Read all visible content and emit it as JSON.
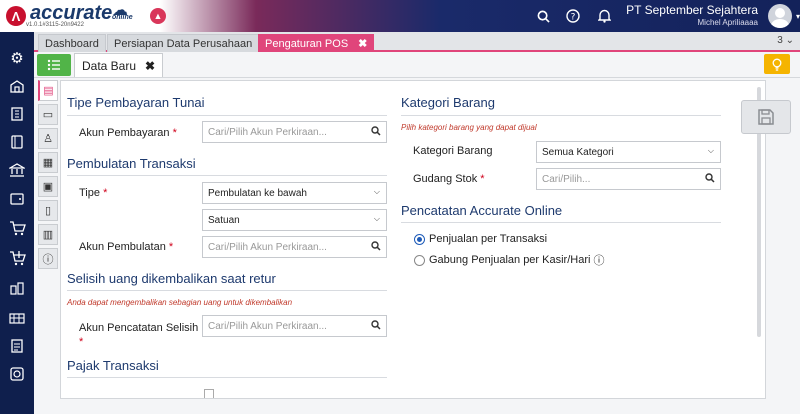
{
  "app": {
    "logo_text": "accurate",
    "logo_sub": "online",
    "version": "v1.0.1#3115-20n9422",
    "company_name": "PT September Sejahtera",
    "user_name": "Michel Apriliaaaa",
    "circle_badge": "▲"
  },
  "tabs": [
    {
      "label": "Dashboard"
    },
    {
      "label": "Persiapan Data Perusahaan"
    },
    {
      "label": "Pengaturan POS",
      "close": "✖"
    }
  ],
  "tab_count": "3 ⌄",
  "subtab": {
    "label": "Data Baru",
    "close": "✖"
  },
  "sections": {
    "tipe_pembayaran": {
      "title": "Tipe Pembayaran Tunai",
      "akun_label": "Akun Pembayaran",
      "akun_placeholder": "Cari/Pilih Akun Perkiraan..."
    },
    "pembulatan": {
      "title": "Pembulatan Transaksi",
      "tipe_label": "Tipe",
      "tipe_value": "Pembulatan ke bawah",
      "satuan_value": "Satuan",
      "akun_label": "Akun Pembulatan",
      "akun_placeholder": "Cari/Pilih Akun Perkiraan..."
    },
    "selisih": {
      "title": "Selisih uang dikembalikan saat retur",
      "note": "Anda dapat mengembalikan sebagian uang untuk dikembalikan",
      "akun_label": "Akun Pencatatan Selisih",
      "akun_placeholder": "Cari/Pilih Akun Perkiraan..."
    },
    "pajak": {
      "title": "Pajak Transaksi"
    },
    "kategori": {
      "title": "Kategori Barang",
      "note": "Pilih kategori barang yang dapat dijual",
      "kategori_label": "Kategori Barang",
      "kategori_value": "Semua Kategori",
      "gudang_label": "Gudang Stok",
      "gudang_placeholder": "Cari/Pilih..."
    },
    "pencatatan": {
      "title": "Pencatatan Accurate Online",
      "opt1": "Penjualan per Transaksi",
      "opt2": "Gabung Penjualan per Kasir/Hari",
      "opt2_info": "ⓘ"
    }
  },
  "required_mark": "*",
  "icons": {
    "search": "🔍",
    "help": "?",
    "bell": "🔔"
  }
}
